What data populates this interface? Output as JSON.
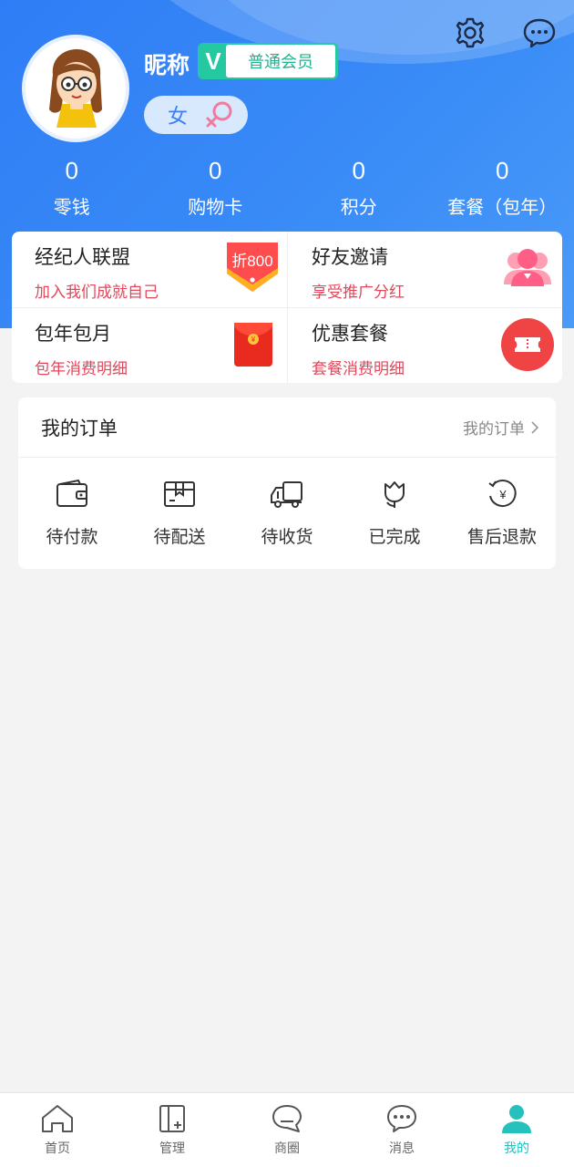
{
  "header": {
    "nickname": "昵称",
    "member_v": "V",
    "member_level": "普通会员",
    "gender_label": "女"
  },
  "stats": [
    {
      "value": "0",
      "label": "零钱"
    },
    {
      "value": "0",
      "label": "购物卡"
    },
    {
      "value": "0",
      "label": "积分"
    },
    {
      "value": "0",
      "label": "套餐（包年）"
    }
  ],
  "features": [
    {
      "title": "经纪人联盟",
      "subtitle": "加入我们成就自己",
      "icon": "discount-tag-icon",
      "badge": "折800"
    },
    {
      "title": "好友邀请",
      "subtitle": "享受推广分红",
      "icon": "friends-icon"
    },
    {
      "title": "包年包月",
      "subtitle": "包年消费明细",
      "icon": "red-envelope-icon"
    },
    {
      "title": "优惠套餐",
      "subtitle": "套餐消费明细",
      "icon": "ticket-icon"
    }
  ],
  "orders": {
    "title": "我的订单",
    "more": "我的订单",
    "items": [
      {
        "label": "待付款",
        "icon": "wallet-icon"
      },
      {
        "label": "待配送",
        "icon": "package-icon"
      },
      {
        "label": "待收货",
        "icon": "truck-icon"
      },
      {
        "label": "已完成",
        "icon": "flower-icon"
      },
      {
        "label": "售后退款",
        "icon": "refund-icon"
      }
    ]
  },
  "tabbar": [
    {
      "label": "首页",
      "icon": "home-icon"
    },
    {
      "label": "管理",
      "icon": "manage-icon"
    },
    {
      "label": "商圈",
      "icon": "chat-bubble-icon"
    },
    {
      "label": "消息",
      "icon": "message-icon"
    },
    {
      "label": "我的",
      "icon": "profile-icon",
      "active": true
    }
  ],
  "colors": {
    "header_blue": "#2f7df6",
    "accent_teal": "#26c0bd",
    "member_green": "#25c9a1",
    "subtitle_red": "#e2475b"
  }
}
